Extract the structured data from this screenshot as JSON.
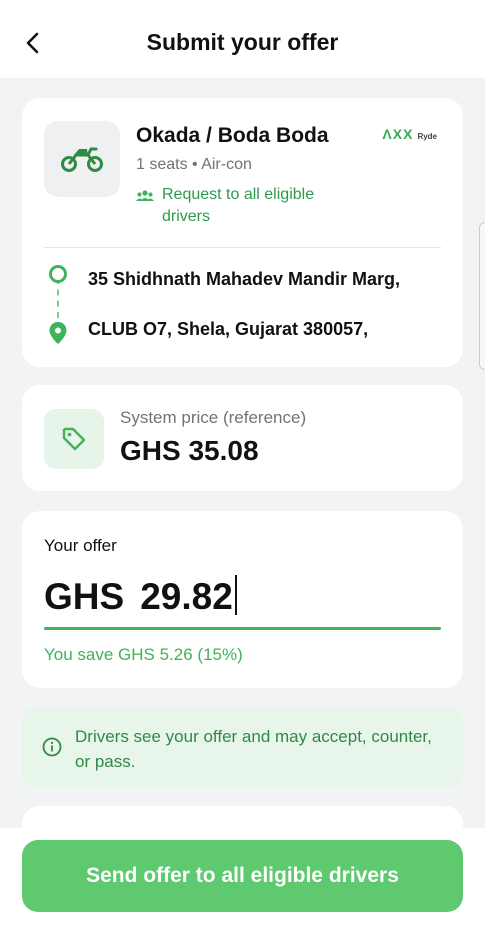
{
  "header": {
    "title": "Submit your offer",
    "back_icon": "chevron-left-icon"
  },
  "ride": {
    "name": "Okada / Boda Boda",
    "brand_mark": "ΛXX",
    "brand_sub": "Ryde",
    "meta": "1 seats • Air-con",
    "request_text": "Request to all eligible drivers",
    "origin": "35 Shidhnath Mahadev Mandir Marg,",
    "destination": "CLUB O7, Shela, Gujarat 380057,"
  },
  "system_price": {
    "label": "System price (reference)",
    "value": "GHS 35.08"
  },
  "offer": {
    "label": "Your offer",
    "currency": "GHS",
    "amount": "29.82",
    "savings": "You save GHS 5.26 (15%)"
  },
  "info": {
    "text": "Drivers see your offer and may accept, counter, or pass."
  },
  "action": {
    "send_label": "Send offer to all eligible drivers"
  },
  "colors": {
    "accent": "#3fb35a",
    "button": "#5ec96f",
    "info_bg": "#e8f5eb"
  }
}
